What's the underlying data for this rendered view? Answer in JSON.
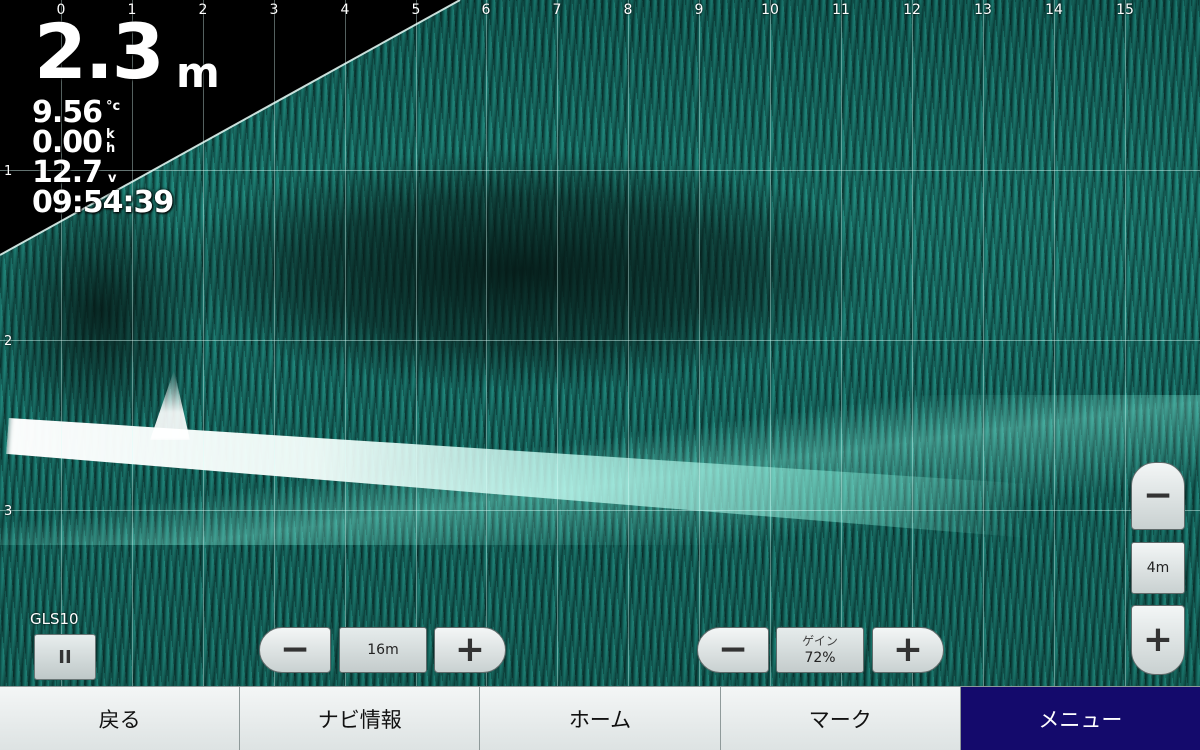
{
  "sonar": {
    "x_ticks": [
      "0",
      "1",
      "2",
      "3",
      "4",
      "5",
      "6",
      "7",
      "8",
      "9",
      "10",
      "11",
      "12",
      "13",
      "14",
      "15"
    ],
    "y_ticks": [
      "1",
      "2",
      "3"
    ]
  },
  "readouts": {
    "depth": {
      "value": "2.3",
      "unit": "m"
    },
    "water_temp": {
      "value": "9.56",
      "unit": "°c"
    },
    "speed": {
      "value": "0.00",
      "unit": "k\nh"
    },
    "voltage": {
      "value": "12.7",
      "unit": "v"
    },
    "time": "09:54:39"
  },
  "source": {
    "name": "GLS10",
    "pause_label": "II"
  },
  "range_control": {
    "minus": "−",
    "value": "16m",
    "plus": "+"
  },
  "gain_control": {
    "minus": "−",
    "label": "ゲイン",
    "value": "72%",
    "plus": "+"
  },
  "zoom_control": {
    "minus": "−",
    "value": "4m",
    "plus": "+"
  },
  "nav": {
    "back": "戻る",
    "nav_info": "ナビ情報",
    "home": "ホーム",
    "mark": "マーク",
    "menu": "メニュー"
  },
  "colors": {
    "sonar_base": "#1a7a70",
    "menu_active": "#140a6c"
  }
}
